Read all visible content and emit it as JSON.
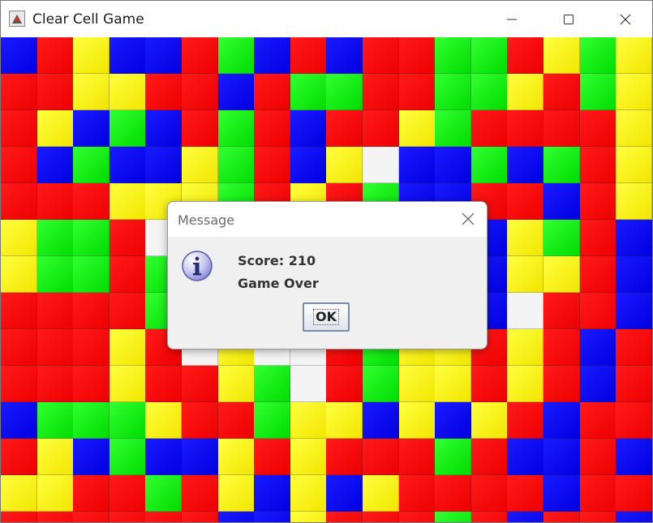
{
  "window": {
    "title": "Clear Cell Game",
    "controls": [
      "minimize-icon",
      "maximize-icon",
      "close-icon"
    ]
  },
  "board": {
    "rows": [
      "BRYBBRGBRBRRGGRYGY",
      "RRYYRRBRGGRRGGYRGY",
      "RYBGBRGRBRRYGRRRRY",
      "RBGBBYGRBYWBBGBGRY",
      "RRRYYYGRYRGBBRRBRY",
      "YGGRWRRBRRRBBBYGRB",
      "YGGRGRRRRRRRRBYYRB",
      "RRRRGRRRRRRRRBWRRB",
      "RRRYRWYWWRGYYRYRBR",
      "RRRYRRYGWRGYYRYRBR",
      "BGGGYRRGYYBYBYRBRR",
      "RYBGBBYRYRRRGRBBRB",
      "YYRRGRYBYBYRRRRBRR",
      "RRRRRRBBYRRRGRBRRB"
    ]
  },
  "dialog": {
    "title": "Message",
    "icon": "info-icon",
    "score_text": "Score: 210",
    "status_text": "Game Over",
    "ok_label": "OK"
  }
}
